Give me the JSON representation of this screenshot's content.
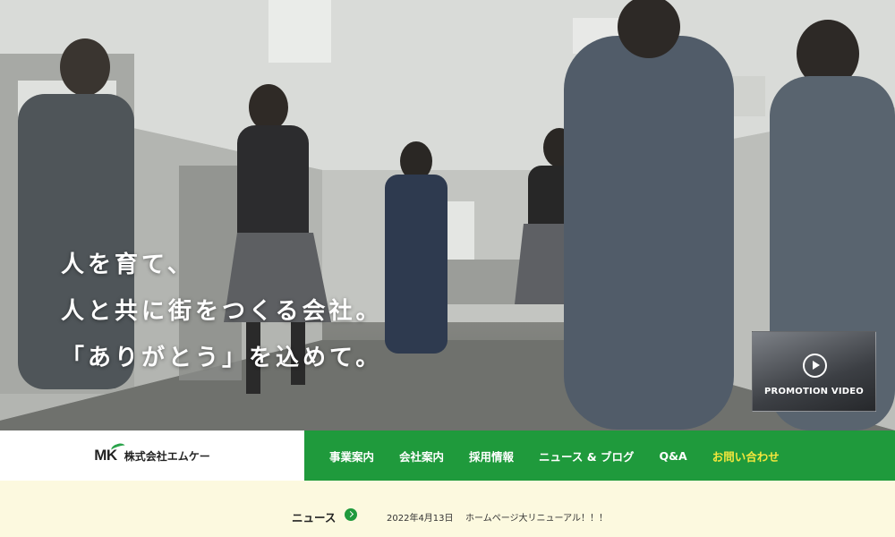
{
  "hero": {
    "tagline": [
      "人を育て、",
      "人と共に街をつくる会社。",
      "「ありがとう」を込めて。"
    ],
    "promo_label": "PROMOTION VIDEO"
  },
  "header": {
    "logo_mark": "MK",
    "company_name": "株式会社エムケー"
  },
  "nav": {
    "items": [
      "事業案内",
      "会社案内",
      "採用情報",
      "ニュース & ブログ",
      "Q&A"
    ],
    "contact": "お問い合わせ"
  },
  "news": {
    "title": "ニュース",
    "date": "2022年4月13日",
    "headline": "ホームページ大リニューアル！！！"
  },
  "colors": {
    "accent_green": "#1f9a3c",
    "contact_yellow": "#f4e73c",
    "news_bg": "#fcf9df"
  },
  "icons": [
    "play-icon",
    "arrow-right-circle-icon",
    "mk-logo-swoosh-icon"
  ]
}
